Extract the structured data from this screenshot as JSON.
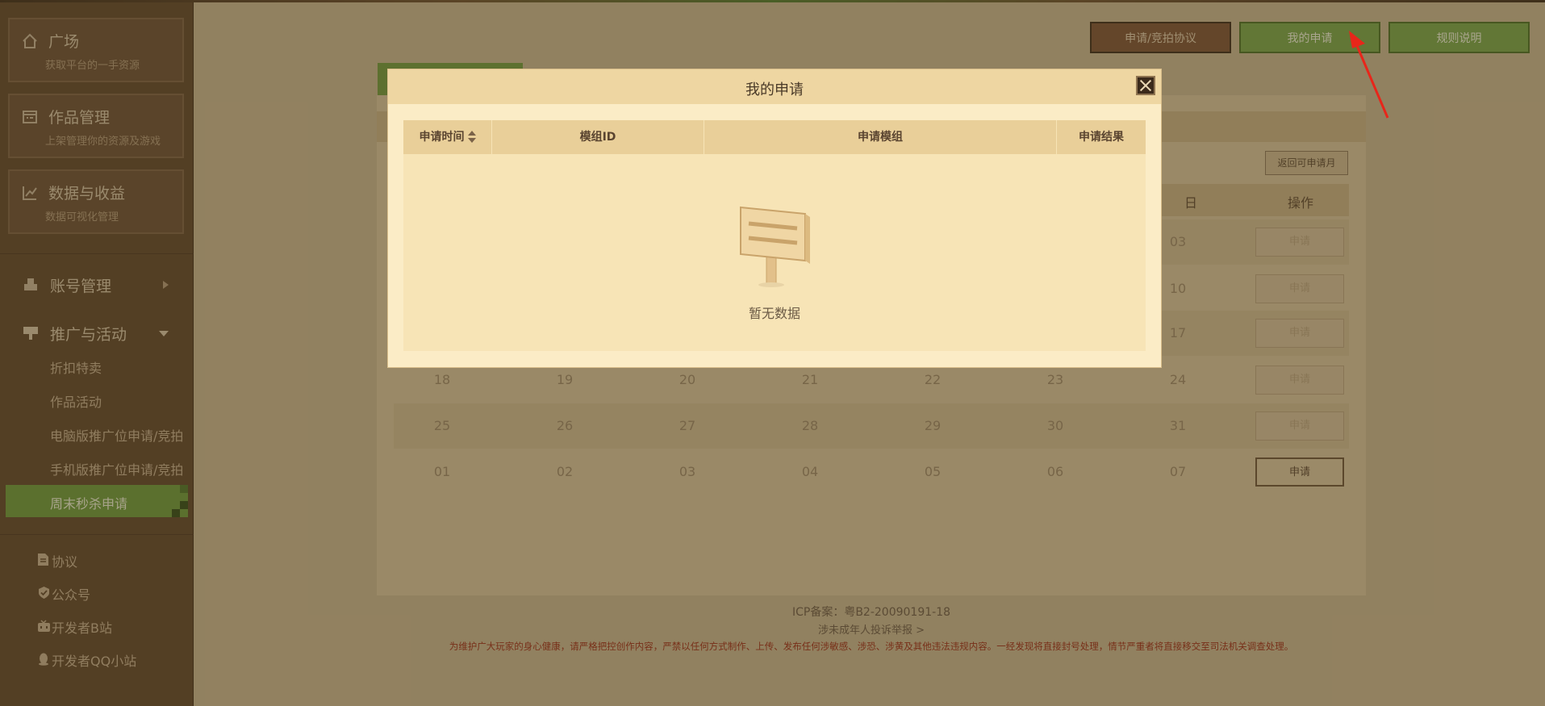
{
  "sidebar": {
    "cards": [
      {
        "title": "广场",
        "subtitle": "获取平台的一手资源",
        "icon": "home-icon"
      },
      {
        "title": "作品管理",
        "subtitle": "上架管理你的资源及游戏",
        "icon": "works-icon"
      },
      {
        "title": "数据与收益",
        "subtitle": "数据可视化管理",
        "icon": "chart-icon"
      }
    ],
    "groups": [
      {
        "label": "账号管理",
        "icon": "account-icon"
      },
      {
        "label": "推广与活动",
        "icon": "promotion-icon"
      }
    ],
    "promotion_items": [
      "折扣特卖",
      "作品活动",
      "电脑版推广位申请/竞拍",
      "手机版推广位申请/竞拍",
      "周末秒杀申请"
    ],
    "links": [
      {
        "label": "协议",
        "icon": "document-icon"
      },
      {
        "label": "公众号",
        "icon": "shield-icon"
      },
      {
        "label": "开发者B站",
        "icon": "tv-icon"
      },
      {
        "label": "开发者QQ小站",
        "icon": "qq-icon"
      }
    ]
  },
  "topbar": {
    "btn_agreement": "申请/竞拍协议",
    "btn_my_apply": "我的申请",
    "btn_rules": "规则说明"
  },
  "panel": {
    "back_button": "返回可申请月",
    "header_day": "日",
    "header_action": "操作",
    "apply_label": "申请",
    "rows": [
      [
        "",
        "",
        "",
        "",
        "",
        "",
        "03"
      ],
      [
        "",
        "",
        "",
        "",
        "",
        "",
        "10"
      ],
      [
        "",
        "",
        "",
        "",
        "",
        "",
        "17"
      ],
      [
        "18",
        "19",
        "20",
        "21",
        "22",
        "23",
        "24"
      ],
      [
        "25",
        "26",
        "27",
        "28",
        "29",
        "30",
        "31"
      ],
      [
        "01",
        "02",
        "03",
        "04",
        "05",
        "06",
        "07"
      ]
    ]
  },
  "footer": {
    "icp": "ICP备案：粤B2-20090191-18",
    "report": "涉未成年人投诉举报 >",
    "warning": "为维护广大玩家的身心健康，请严格把控创作内容，严禁以任何方式制作、上传、发布任何涉敏感、涉恐、涉黄及其他违法违规内容。一经发现将直接封号处理，情节严重者将直接移交至司法机关调查处理。"
  },
  "modal": {
    "title": "我的申请",
    "columns": [
      "申请时间",
      "模组ID",
      "申请模组",
      "申请结果"
    ],
    "empty_text": "暂无数据"
  },
  "colors": {
    "accent_green": "#77a548",
    "brown": "#5e4529",
    "modal_bg": "#fbecc6",
    "annotation_red": "#e8261a"
  }
}
